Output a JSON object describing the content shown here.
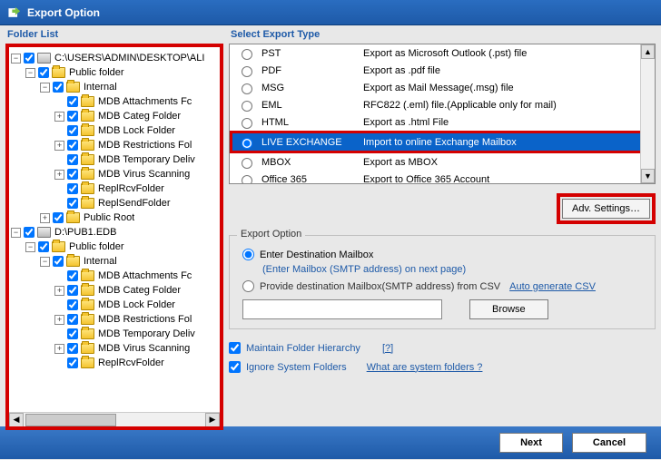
{
  "titlebar": {
    "title": "Export Option"
  },
  "left": {
    "label": "Folder List",
    "roots": [
      {
        "icon": "drive",
        "label": "C:\\USERS\\ADMIN\\DESKTOP\\ALI",
        "exp": "-",
        "children": [
          {
            "icon": "folder",
            "label": "Public folder",
            "exp": "-",
            "indent": 1,
            "children": [
              {
                "icon": "folder",
                "label": "Internal",
                "exp": "-",
                "indent": 2,
                "children": [
                  {
                    "icon": "folder",
                    "label": "MDB Attachments Fc",
                    "exp": "",
                    "indent": 3
                  },
                  {
                    "icon": "folder",
                    "label": "MDB Categ Folder",
                    "exp": "+",
                    "indent": 3
                  },
                  {
                    "icon": "folder",
                    "label": "MDB Lock Folder",
                    "exp": "",
                    "indent": 3
                  },
                  {
                    "icon": "folder",
                    "label": "MDB Restrictions Fol",
                    "exp": "+",
                    "indent": 3
                  },
                  {
                    "icon": "folder",
                    "label": "MDB Temporary Deliv",
                    "exp": "",
                    "indent": 3
                  },
                  {
                    "icon": "folder",
                    "label": "MDB Virus Scanning",
                    "exp": "+",
                    "indent": 3
                  },
                  {
                    "icon": "folder",
                    "label": "ReplRcvFolder",
                    "exp": "",
                    "indent": 3
                  },
                  {
                    "icon": "folder",
                    "label": "ReplSendFolder",
                    "exp": "",
                    "indent": 3
                  }
                ]
              },
              {
                "icon": "folder",
                "label": "Public Root",
                "exp": "+",
                "indent": 2
              }
            ]
          }
        ]
      },
      {
        "icon": "drive",
        "label": "D:\\PUB1.EDB",
        "exp": "-",
        "children": [
          {
            "icon": "folder",
            "label": "Public folder",
            "exp": "-",
            "indent": 1,
            "children": [
              {
                "icon": "folder",
                "label": "Internal",
                "exp": "-",
                "indent": 2,
                "children": [
                  {
                    "icon": "folder",
                    "label": "MDB Attachments Fc",
                    "exp": "",
                    "indent": 3
                  },
                  {
                    "icon": "folder",
                    "label": "MDB Categ Folder",
                    "exp": "+",
                    "indent": 3
                  },
                  {
                    "icon": "folder",
                    "label": "MDB Lock Folder",
                    "exp": "",
                    "indent": 3
                  },
                  {
                    "icon": "folder",
                    "label": "MDB Restrictions Fol",
                    "exp": "+",
                    "indent": 3
                  },
                  {
                    "icon": "folder",
                    "label": "MDB Temporary Deliv",
                    "exp": "",
                    "indent": 3
                  },
                  {
                    "icon": "folder",
                    "label": "MDB Virus Scanning",
                    "exp": "+",
                    "indent": 3
                  },
                  {
                    "icon": "folder",
                    "label": "ReplRcvFolder",
                    "exp": "",
                    "indent": 3
                  }
                ]
              }
            ]
          }
        ]
      }
    ]
  },
  "right": {
    "label": "Select Export Type",
    "types": [
      {
        "fmt": "PST",
        "desc": "Export as Microsoft Outlook (.pst) file"
      },
      {
        "fmt": "PDF",
        "desc": "Export as .pdf file"
      },
      {
        "fmt": "MSG",
        "desc": "Export as Mail Message(.msg) file"
      },
      {
        "fmt": "EML",
        "desc": "RFC822 (.eml) file.(Applicable only for mail)"
      },
      {
        "fmt": "HTML",
        "desc": "Export as .html File"
      },
      {
        "fmt": "LIVE EXCHANGE",
        "desc": "Import to online Exchange Mailbox",
        "selected": true
      },
      {
        "fmt": "MBOX",
        "desc": "Export as MBOX"
      },
      {
        "fmt": "Office 365",
        "desc": "Export to Office 365 Account"
      }
    ],
    "adv_btn": "Adv. Settings…",
    "group_title": "Export Option",
    "opt1": "Enter Destination Mailbox",
    "opt1_hint": "(Enter Mailbox (SMTP address) on next page)",
    "opt2": "Provide destination Mailbox(SMTP address) from CSV",
    "opt2_link": "Auto generate CSV",
    "browse": "Browse",
    "chk1": "Maintain Folder Hierarchy",
    "chk1_q": "[?]",
    "chk2": "Ignore System Folders",
    "chk2_link": "What are system folders ?"
  },
  "footer": {
    "next": "Next",
    "cancel": "Cancel"
  }
}
